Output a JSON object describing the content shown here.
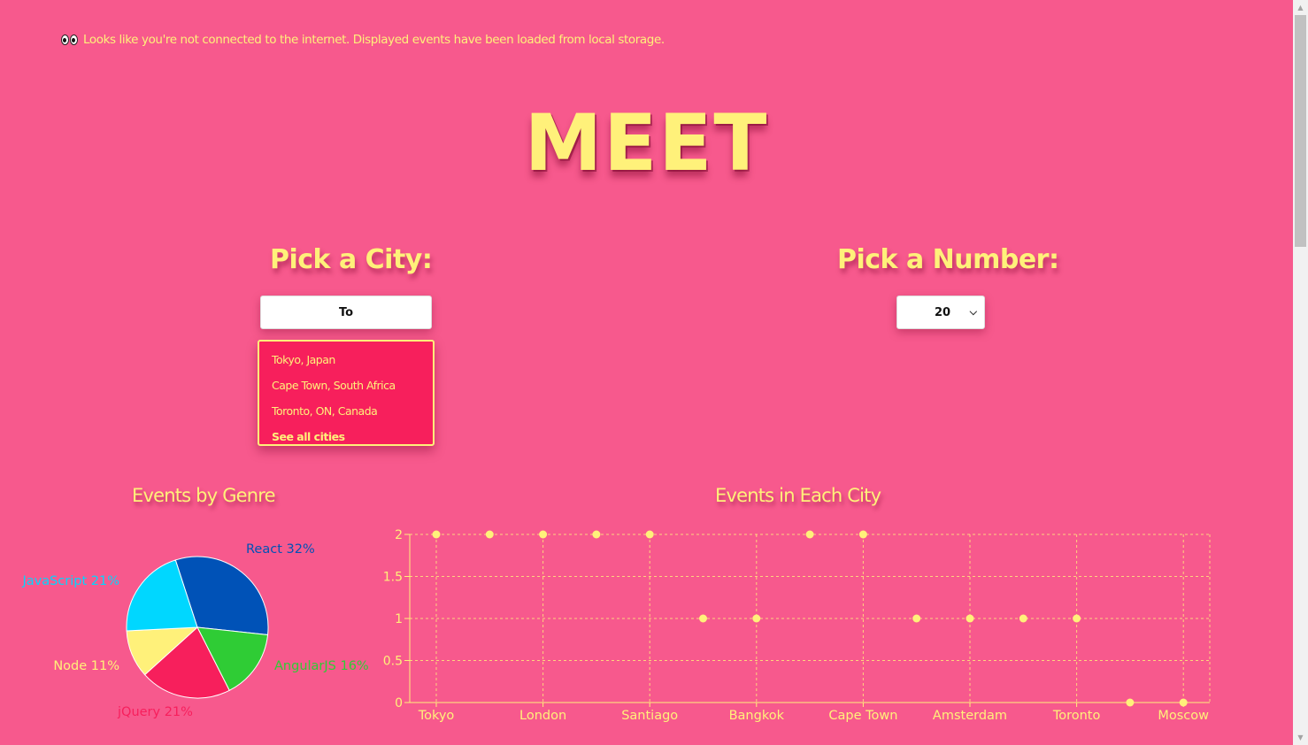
{
  "alert": {
    "text": "Looks like you're not connected to the internet. Displayed events have been loaded from local storage."
  },
  "app": {
    "title": "MEET"
  },
  "city": {
    "heading": "Pick a City:",
    "input_value": "To",
    "suggestions": [
      "Tokyo, Japan",
      "Cape Town, South Africa",
      "Toronto, ON, Canada"
    ],
    "see_all": "See all cities"
  },
  "number": {
    "heading": "Pick a Number:",
    "selected": "20"
  },
  "genre_chart": {
    "title": "Events by Genre"
  },
  "city_chart": {
    "title": "Events in Each City"
  },
  "colors": {
    "background": "#f7598d",
    "accent_yellow": "#fff17a",
    "dropdown_bg": "#f71f5c"
  },
  "chart_data": [
    {
      "type": "pie",
      "title": "Events by Genre",
      "slices": [
        {
          "name": "React",
          "label": "React 32%",
          "value": 32,
          "color": "#0052b7"
        },
        {
          "name": "AngularJS",
          "label": "AngularJS 16%",
          "value": 16,
          "color": "#2fcc35"
        },
        {
          "name": "jQuery",
          "label": "jQuery 21%",
          "value": 21,
          "color": "#f71f5c"
        },
        {
          "name": "Node",
          "label": "Node 11%",
          "value": 11,
          "color": "#fff17a"
        },
        {
          "name": "JavaScript",
          "label": "JavaScript 21%",
          "value": 21,
          "color": "#00d7ff"
        }
      ]
    },
    {
      "type": "scatter",
      "title": "Events in Each City",
      "x_tick_labels": [
        "Tokyo",
        "London",
        "Santiago",
        "Bangkok",
        "Cape Town",
        "Amsterdam",
        "Toronto",
        "Moscow"
      ],
      "y_ticks": [
        "0",
        "0.5",
        "1",
        "1.5",
        "2"
      ],
      "ylim": [
        0,
        2
      ],
      "grid": true,
      "y": [
        2,
        2,
        2,
        2,
        2,
        1,
        1,
        2,
        2,
        1,
        1,
        1,
        1,
        0,
        0
      ]
    }
  ]
}
